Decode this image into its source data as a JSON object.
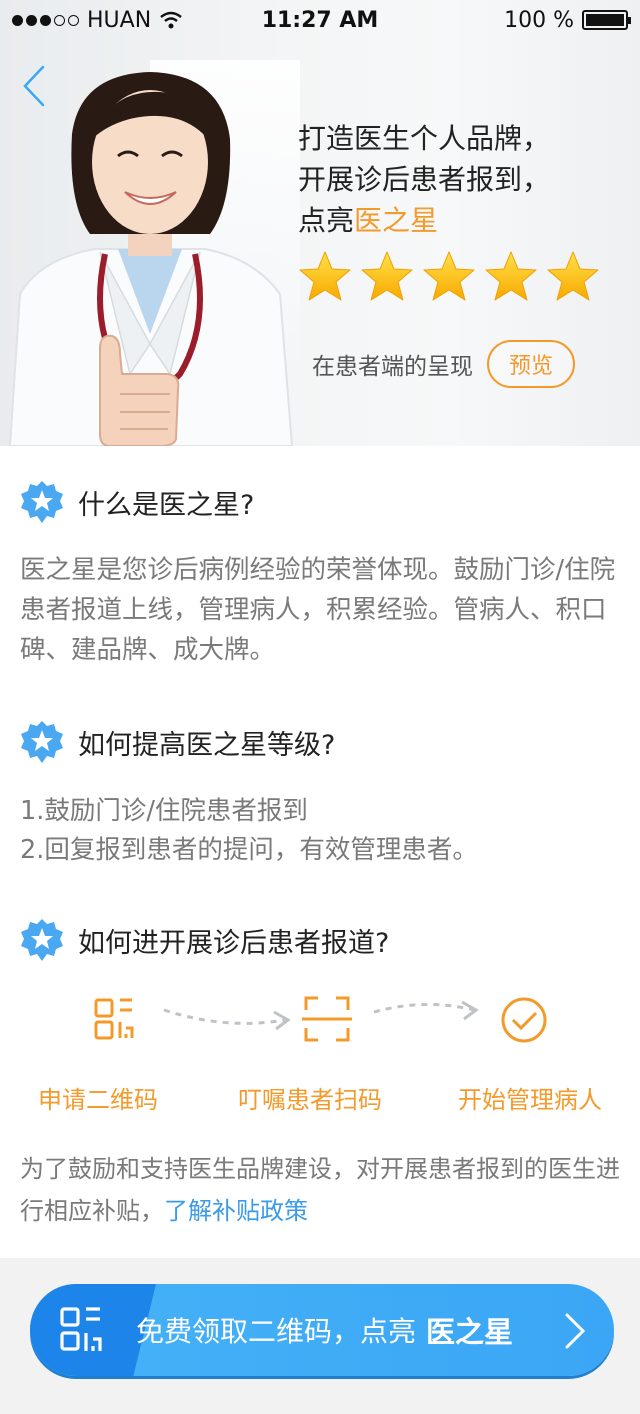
{
  "status_bar": {
    "carrier": "HUAN",
    "time": "11:27 AM",
    "battery": "100 %",
    "battery_level": 1.0
  },
  "hero": {
    "headline_line1": "打造医生个人品牌，",
    "headline_line2": "开展诊后患者报到，",
    "headline_line3_prefix": "点亮",
    "headline_line3_highlight": "医之星",
    "rating_stars": 5,
    "preview_caption": "在患者端的呈现",
    "preview_button": "预览"
  },
  "sections": {
    "what": {
      "title": "什么是医之星?",
      "body": "医之星是您诊后病例经验的荣誉体现。鼓励门诊/住院患者报道上线，管理病人，积累经验。管病人、积口碑、建品牌、成大牌。"
    },
    "improve": {
      "title": "如何提高医之星等级?",
      "item1": "1.鼓励门诊/住院患者报到",
      "item2": "2.回复报到患者的提问，有效管理患者。"
    },
    "howto": {
      "title": "如何进开展诊后患者报道?",
      "step1": "申请二维码",
      "step2": "叮嘱患者扫码",
      "step3": "开始管理病人"
    }
  },
  "subsidy": {
    "text": "为了鼓励和支持医生品牌建设，对开展患者报到的医生进行相应补贴，",
    "link": "了解补贴政策"
  },
  "cta": {
    "label": "免费领取二维码，点亮",
    "bold": "医之星"
  },
  "colors": {
    "accent_orange": "#f39a2b",
    "accent_blue": "#3aa6f5",
    "link_blue": "#3a9be6",
    "star_yellow": "#ffc20e"
  }
}
